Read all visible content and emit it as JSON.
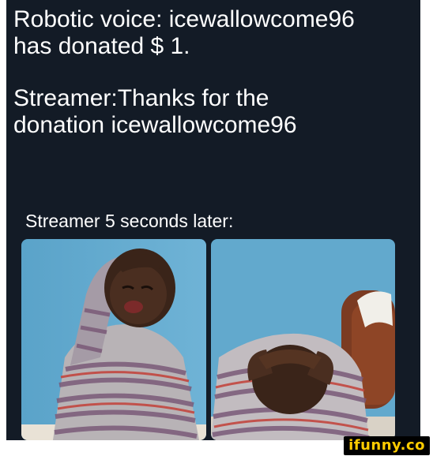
{
  "meme": {
    "line1": "Robotic voice: icewallowcome96",
    "line2": "has donated $ 1.",
    "line3": "Streamer:Thanks for the",
    "line4": "donation icewallowcome96",
    "line5": "Streamer 5 seconds later:"
  },
  "watermark": "ifunny.co",
  "colors": {
    "background": "#131b26",
    "text": "#ffffff",
    "watermark_bg": "#000000",
    "watermark_text": "#ffcc00"
  }
}
